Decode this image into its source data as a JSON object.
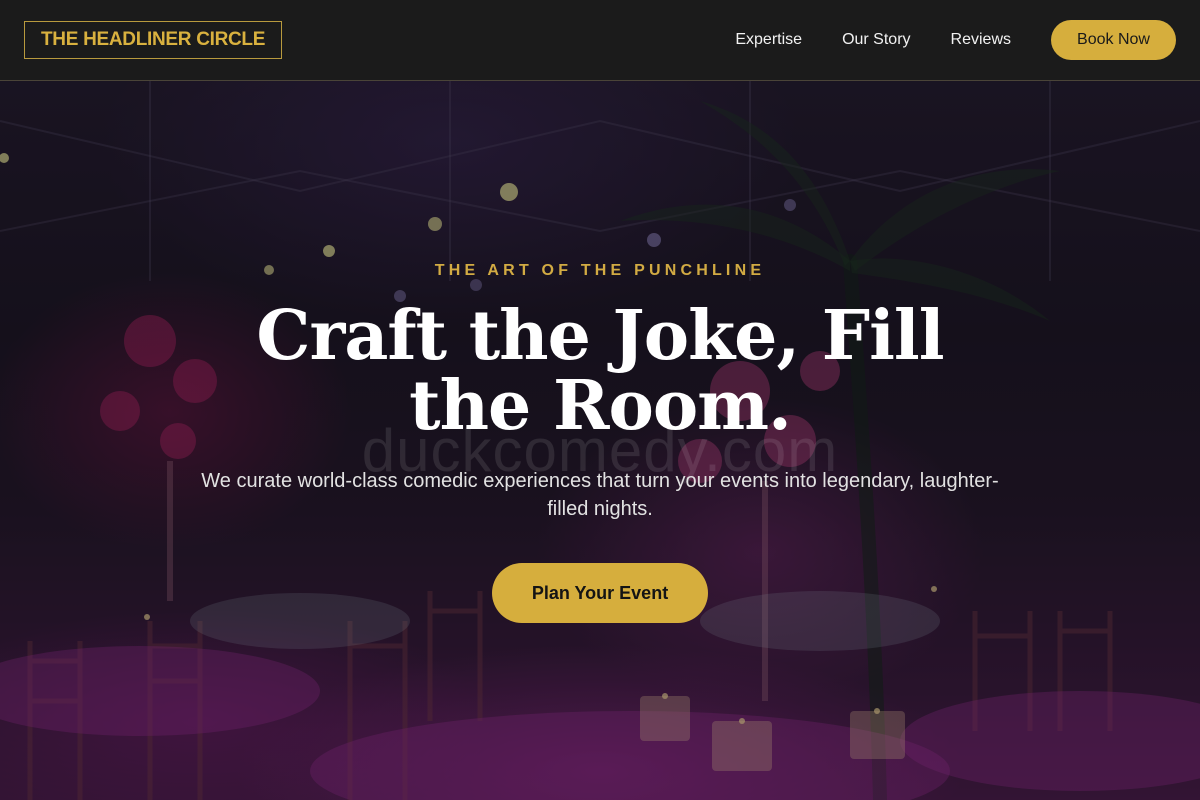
{
  "header": {
    "logo_text": "THE HEADLINER CIRCLE",
    "nav": [
      {
        "label": "Expertise"
      },
      {
        "label": "Our Story"
      },
      {
        "label": "Reviews"
      }
    ],
    "book_label": "Book Now"
  },
  "hero": {
    "eyebrow": "THE ART OF THE PUNCHLINE",
    "headline": "Craft the Joke, Fill the Room.",
    "subtext": "We curate world-class comedic experiences that turn your events into legendary, laughter-filled nights.",
    "cta_label": "Plan Your Event",
    "watermark": "duckcomedy.com",
    "background": "dark-event-venue-photo"
  },
  "colors": {
    "accent_gold": "#d6ae3d",
    "header_bg": "#1b1b1b",
    "text_white": "#ffffff"
  }
}
